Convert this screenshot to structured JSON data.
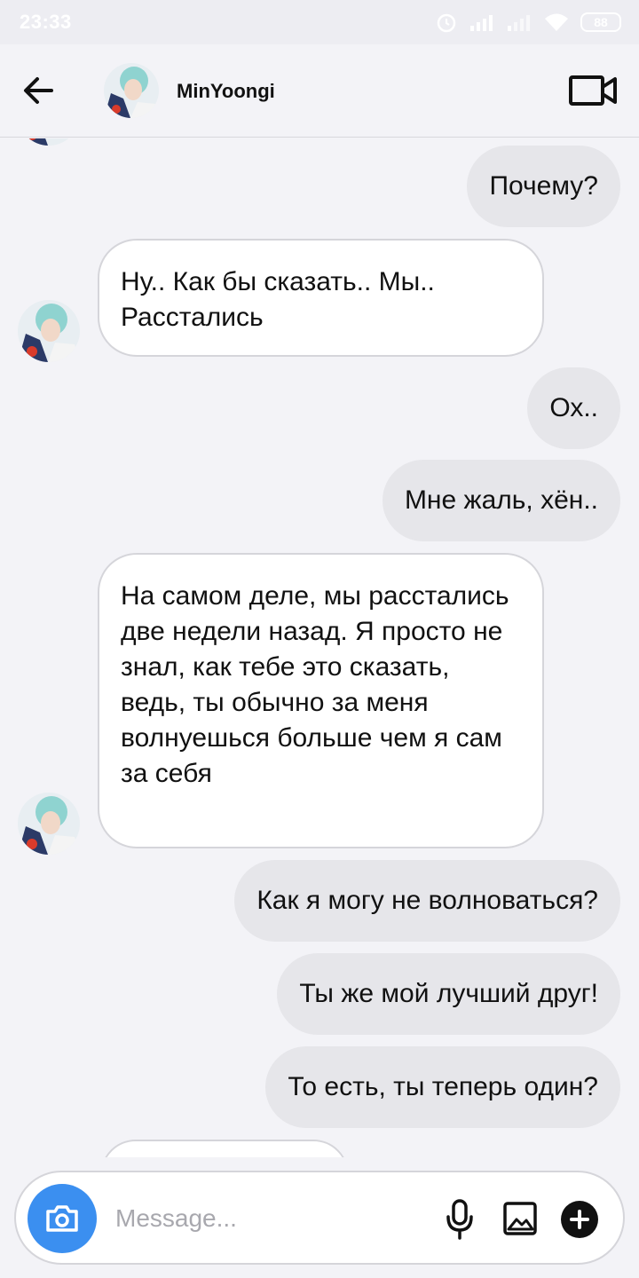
{
  "status_bar": {
    "time": "23:33",
    "battery": "88"
  },
  "header": {
    "contact_name": "MinYoongi"
  },
  "messages": [
    {
      "direction": "out",
      "text": "Почему?"
    },
    {
      "direction": "in",
      "text": "Ну.. Как бы сказать.. Мы.. Расстались"
    },
    {
      "direction": "out",
      "text": "Ох.."
    },
    {
      "direction": "out",
      "text": "Мне жаль, хён.."
    },
    {
      "direction": "in",
      "text": "На самом деле, мы расстались две недели назад. Я просто не знал, как тебе это сказать, ведь, ты обычно за меня волнуешься больше чем я сам за себя"
    },
    {
      "direction": "out",
      "text": "Как я могу не волноваться?"
    },
    {
      "direction": "out",
      "text": "Ты же мой лучший друг!"
    },
    {
      "direction": "out",
      "text": "То есть, ты теперь один?"
    }
  ],
  "composer": {
    "placeholder": "Message..."
  },
  "icons": {
    "back": "arrow-left-icon",
    "video": "video-camera-icon",
    "camera": "camera-icon",
    "mic": "microphone-icon",
    "gallery": "image-icon",
    "add": "plus-circle-icon"
  },
  "colors": {
    "background": "#f3f3f7",
    "outgoing_bubble": "#e6e6ea",
    "incoming_bubble": "#ffffff",
    "camera_button": "#3b8ff0"
  }
}
